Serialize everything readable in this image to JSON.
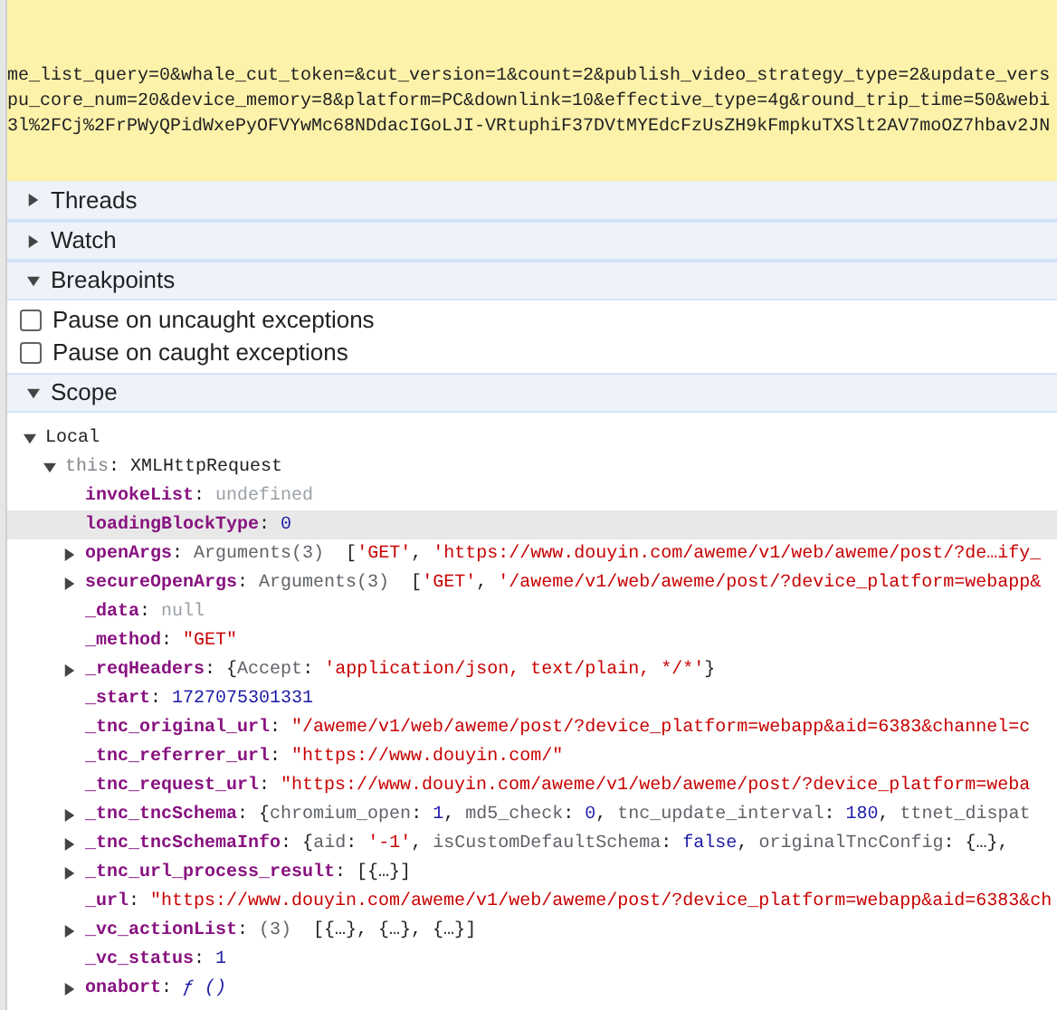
{
  "request_url_lines": [
    "me_list_query=0&whale_cut_token=&cut_version=1&count=2&publish_video_strategy_type=2&update_vers",
    "pu_core_num=20&device_memory=8&platform=PC&downlink=10&effective_type=4g&round_trip_time=50&webi",
    "3l%2FCj%2FrPWyQPidWxePyOFVYwMc68NDdacIGoLJI-VRtuphiF37DVtMYEdcFzUsZH9kFmpkuTXSlt2AV7moOZ7hbav2JN"
  ],
  "sections": [
    {
      "title": "Threads",
      "expanded": false
    },
    {
      "title": "Watch",
      "expanded": false
    },
    {
      "title": "Breakpoints",
      "expanded": true,
      "options": [
        {
          "label": "Pause on uncaught exceptions",
          "checked": false
        },
        {
          "label": "Pause on caught exceptions",
          "checked": false
        }
      ]
    },
    {
      "title": "Scope",
      "expanded": true,
      "tree": [
        {
          "kind": "scope",
          "name": "Local",
          "expanded": true,
          "children": [
            {
              "kind": "receiver",
              "name": "this",
              "expanded": true,
              "value": [
                {
                  "text": ": ",
                  "kind": "plain"
                },
                {
                  "text": "XMLHttpRequest",
                  "kind": "plain"
                }
              ],
              "children": [
                {
                  "kind": "property",
                  "name": "invokeList",
                  "selected": false,
                  "value": [
                    {
                      "text": ": ",
                      "kind": "plain"
                    },
                    {
                      "text": "undefined",
                      "kind": "dim"
                    }
                  ]
                },
                {
                  "kind": "property",
                  "name": "loadingBlockType",
                  "selected": true,
                  "value": [
                    {
                      "text": ": ",
                      "kind": "plain"
                    },
                    {
                      "text": "0",
                      "kind": "number"
                    }
                  ]
                },
                {
                  "kind": "property",
                  "name": "openArgs",
                  "selected": false,
                  "expanded": false,
                  "value": [
                    {
                      "text": ": ",
                      "kind": "plain"
                    },
                    {
                      "text": "Arguments(3)",
                      "kind": "meta"
                    },
                    {
                      "text": "  [",
                      "kind": "plain"
                    },
                    {
                      "text": "'GET'",
                      "kind": "string"
                    },
                    {
                      "text": ", ",
                      "kind": "plain"
                    },
                    {
                      "text": "'https://www.douyin.com/aweme/v1/web/aweme/post/?de…ify_",
                      "kind": "string"
                    }
                  ]
                },
                {
                  "kind": "property",
                  "name": "secureOpenArgs",
                  "selected": false,
                  "expanded": false,
                  "value": [
                    {
                      "text": ": ",
                      "kind": "plain"
                    },
                    {
                      "text": "Arguments(3)",
                      "kind": "meta"
                    },
                    {
                      "text": "  [",
                      "kind": "plain"
                    },
                    {
                      "text": "'GET'",
                      "kind": "string"
                    },
                    {
                      "text": ", ",
                      "kind": "plain"
                    },
                    {
                      "text": "'/aweme/v1/web/aweme/post/?device_platform=webapp&",
                      "kind": "string"
                    }
                  ]
                },
                {
                  "kind": "property",
                  "name": "_data",
                  "selected": false,
                  "value": [
                    {
                      "text": ": ",
                      "kind": "plain"
                    },
                    {
                      "text": "null",
                      "kind": "dim"
                    }
                  ]
                },
                {
                  "kind": "property",
                  "name": "_method",
                  "selected": false,
                  "value": [
                    {
                      "text": ": ",
                      "kind": "plain"
                    },
                    {
                      "text": "\"GET\"",
                      "kind": "string"
                    }
                  ]
                },
                {
                  "kind": "property",
                  "name": "_reqHeaders",
                  "selected": false,
                  "expanded": false,
                  "value": [
                    {
                      "text": ": ",
                      "kind": "plain"
                    },
                    {
                      "text": "{",
                      "kind": "plain"
                    },
                    {
                      "text": "Accept",
                      "kind": "meta"
                    },
                    {
                      "text": ": ",
                      "kind": "plain"
                    },
                    {
                      "text": "'application/json, text/plain, */*'",
                      "kind": "string"
                    },
                    {
                      "text": "}",
                      "kind": "plain"
                    }
                  ]
                },
                {
                  "kind": "property",
                  "name": "_start",
                  "selected": false,
                  "value": [
                    {
                      "text": ": ",
                      "kind": "plain"
                    },
                    {
                      "text": "1727075301331",
                      "kind": "number"
                    }
                  ]
                },
                {
                  "kind": "property",
                  "name": "_tnc_original_url",
                  "selected": false,
                  "value": [
                    {
                      "text": ": ",
                      "kind": "plain"
                    },
                    {
                      "text": "\"/aweme/v1/web/aweme/post/?device_platform=webapp&aid=6383&channel=c",
                      "kind": "string"
                    }
                  ]
                },
                {
                  "kind": "property",
                  "name": "_tnc_referrer_url",
                  "selected": false,
                  "value": [
                    {
                      "text": ": ",
                      "kind": "plain"
                    },
                    {
                      "text": "\"https://www.douyin.com/\"",
                      "kind": "string"
                    }
                  ]
                },
                {
                  "kind": "property",
                  "name": "_tnc_request_url",
                  "selected": false,
                  "value": [
                    {
                      "text": ": ",
                      "kind": "plain"
                    },
                    {
                      "text": "\"https://www.douyin.com/aweme/v1/web/aweme/post/?device_platform=weba",
                      "kind": "string"
                    }
                  ]
                },
                {
                  "kind": "property",
                  "name": "_tnc_tncSchema",
                  "selected": false,
                  "expanded": false,
                  "value": [
                    {
                      "text": ": ",
                      "kind": "plain"
                    },
                    {
                      "text": "{",
                      "kind": "plain"
                    },
                    {
                      "text": "chromium_open",
                      "kind": "meta"
                    },
                    {
                      "text": ": ",
                      "kind": "plain"
                    },
                    {
                      "text": "1",
                      "kind": "number"
                    },
                    {
                      "text": ", ",
                      "kind": "plain"
                    },
                    {
                      "text": "md5_check",
                      "kind": "meta"
                    },
                    {
                      "text": ": ",
                      "kind": "plain"
                    },
                    {
                      "text": "0",
                      "kind": "number"
                    },
                    {
                      "text": ", ",
                      "kind": "plain"
                    },
                    {
                      "text": "tnc_update_interval",
                      "kind": "meta"
                    },
                    {
                      "text": ": ",
                      "kind": "plain"
                    },
                    {
                      "text": "180",
                      "kind": "number"
                    },
                    {
                      "text": ", ",
                      "kind": "plain"
                    },
                    {
                      "text": "ttnet_dispat",
                      "kind": "meta"
                    }
                  ]
                },
                {
                  "kind": "property",
                  "name": "_tnc_tncSchemaInfo",
                  "selected": false,
                  "expanded": false,
                  "value": [
                    {
                      "text": ": ",
                      "kind": "plain"
                    },
                    {
                      "text": "{",
                      "kind": "plain"
                    },
                    {
                      "text": "aid",
                      "kind": "meta"
                    },
                    {
                      "text": ": ",
                      "kind": "plain"
                    },
                    {
                      "text": "'-1'",
                      "kind": "string"
                    },
                    {
                      "text": ", ",
                      "kind": "plain"
                    },
                    {
                      "text": "isCustomDefaultSchema",
                      "kind": "meta"
                    },
                    {
                      "text": ": ",
                      "kind": "plain"
                    },
                    {
                      "text": "false",
                      "kind": "number"
                    },
                    {
                      "text": ", ",
                      "kind": "plain"
                    },
                    {
                      "text": "originalTncConfig",
                      "kind": "meta"
                    },
                    {
                      "text": ": ",
                      "kind": "plain"
                    },
                    {
                      "text": "{…},",
                      "kind": "plain"
                    }
                  ]
                },
                {
                  "kind": "property",
                  "name": "_tnc_url_process_result",
                  "selected": false,
                  "expanded": false,
                  "value": [
                    {
                      "text": ": ",
                      "kind": "plain"
                    },
                    {
                      "text": "[{…}]",
                      "kind": "plain"
                    }
                  ]
                },
                {
                  "kind": "property",
                  "name": "_url",
                  "selected": false,
                  "value": [
                    {
                      "text": ": ",
                      "kind": "plain"
                    },
                    {
                      "text": "\"https://www.douyin.com/aweme/v1/web/aweme/post/?device_platform=webapp&aid=6383&ch",
                      "kind": "string"
                    }
                  ]
                },
                {
                  "kind": "property",
                  "name": "_vc_actionList",
                  "selected": false,
                  "expanded": false,
                  "value": [
                    {
                      "text": ": ",
                      "kind": "plain"
                    },
                    {
                      "text": "(3)",
                      "kind": "meta"
                    },
                    {
                      "text": "  [{…}, {…}, {…}]",
                      "kind": "plain"
                    }
                  ]
                },
                {
                  "kind": "property",
                  "name": "_vc_status",
                  "selected": false,
                  "value": [
                    {
                      "text": ": ",
                      "kind": "plain"
                    },
                    {
                      "text": "1",
                      "kind": "number"
                    }
                  ]
                },
                {
                  "kind": "property",
                  "name": "onabort",
                  "selected": false,
                  "expanded": false,
                  "value": [
                    {
                      "text": ": ",
                      "kind": "plain"
                    },
                    {
                      "text": "ƒ ()",
                      "kind": "function"
                    }
                  ]
                }
              ]
            }
          ]
        }
      ]
    }
  ]
}
